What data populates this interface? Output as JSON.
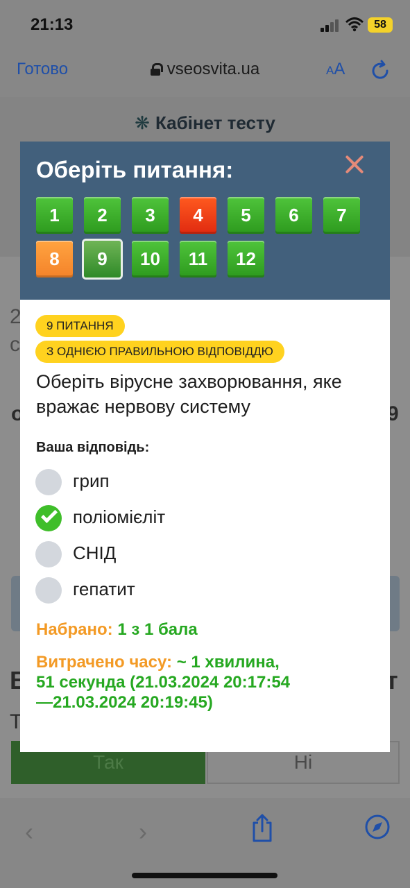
{
  "status_bar": {
    "time": "21:13",
    "battery": "58"
  },
  "browser": {
    "done_label": "Готово",
    "url": "vseosvita.ua",
    "text_size_small": "A",
    "text_size_large": "A"
  },
  "page": {
    "cabinet_title": "Кабінет тесту",
    "bg_yes": "Так",
    "bg_no": "Ні"
  },
  "modal": {
    "title": "Оберіть питання:",
    "questions": [
      {
        "label": "1",
        "state": "correct"
      },
      {
        "label": "2",
        "state": "correct"
      },
      {
        "label": "3",
        "state": "correct"
      },
      {
        "label": "4",
        "state": "wrong"
      },
      {
        "label": "5",
        "state": "correct"
      },
      {
        "label": "6",
        "state": "correct"
      },
      {
        "label": "7",
        "state": "correct"
      },
      {
        "label": "8",
        "state": "partial"
      },
      {
        "label": "9",
        "state": "current"
      },
      {
        "label": "10",
        "state": "correct"
      },
      {
        "label": "11",
        "state": "correct"
      },
      {
        "label": "12",
        "state": "correct"
      }
    ],
    "question_number_badge": "9 ПИТАННЯ",
    "question_type_badge": "З ОДНІЄЮ ПРАВИЛЬНОЮ ВІДПОВІДДЮ",
    "question_text": "Оберіть вірусне захворювання, яке вражає нервову систему",
    "answer_label": "Ваша відповідь:",
    "options": [
      {
        "text": "грип",
        "selected": false
      },
      {
        "text": "поліомієліт",
        "selected": true
      },
      {
        "text": "СНІД",
        "selected": false
      },
      {
        "text": "гепатит",
        "selected": false
      }
    ],
    "score_label": "Набрано:",
    "score_value": "1 з 1 бала",
    "time_label": "Витрачено часу:",
    "time_value_line1": "~ 1 хвилина,",
    "time_value_line2": "51 секунда (21.03.2024 20:17:54",
    "time_value_line3": "—21.03.2024 20:19:45)"
  },
  "colors": {
    "correct": "#3cb52a",
    "wrong": "#f03a14",
    "partial": "#f89236",
    "header_bg": "#42607c",
    "badge": "#ffd21f"
  }
}
